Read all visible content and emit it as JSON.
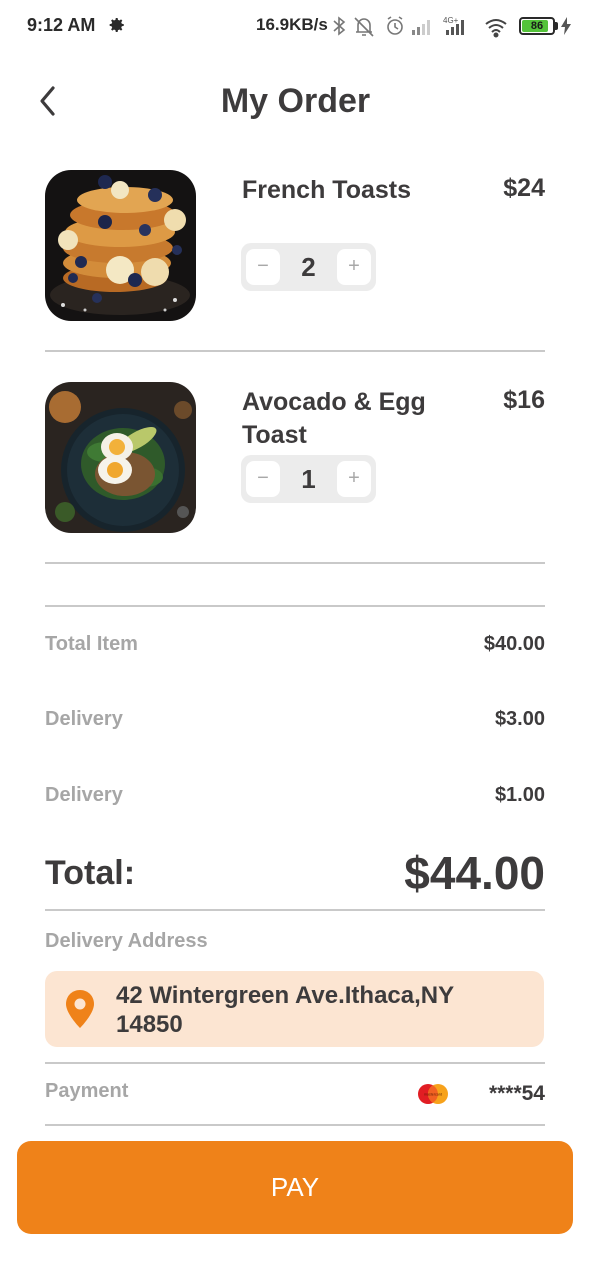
{
  "status_bar": {
    "time": "9:12 AM",
    "speed": "16.9KB/s",
    "network": "4G+",
    "battery": "86",
    "battery_level": 0.86
  },
  "header": {
    "title": "My Order"
  },
  "items": [
    {
      "name": "French Toasts",
      "price": "$24",
      "quantity": "2",
      "minus": "−",
      "plus": "+"
    },
    {
      "name": "Avocado & Egg Toast",
      "price": "$16",
      "quantity": "1",
      "minus": "−",
      "plus": "+"
    }
  ],
  "summary": {
    "rows": [
      {
        "label": "Total Item",
        "value": "$40.00"
      },
      {
        "label": "Delivery",
        "value": "$3.00"
      },
      {
        "label": "Delivery",
        "value": "$1.00"
      }
    ],
    "total_label": "Total:",
    "total_value": "$44.00"
  },
  "address": {
    "label": "Delivery Address",
    "text": "42 Wintergreen Ave.Ithaca,NY 14850"
  },
  "payment": {
    "label": "Payment",
    "card_number": "****54",
    "card_logo_text": "mastercard"
  },
  "pay_button": "PAY",
  "colors": {
    "accent": "#ef8219",
    "address_bg": "#fce5d2",
    "text_dark": "#3d3b3c",
    "text_muted": "#a6a6a6"
  }
}
